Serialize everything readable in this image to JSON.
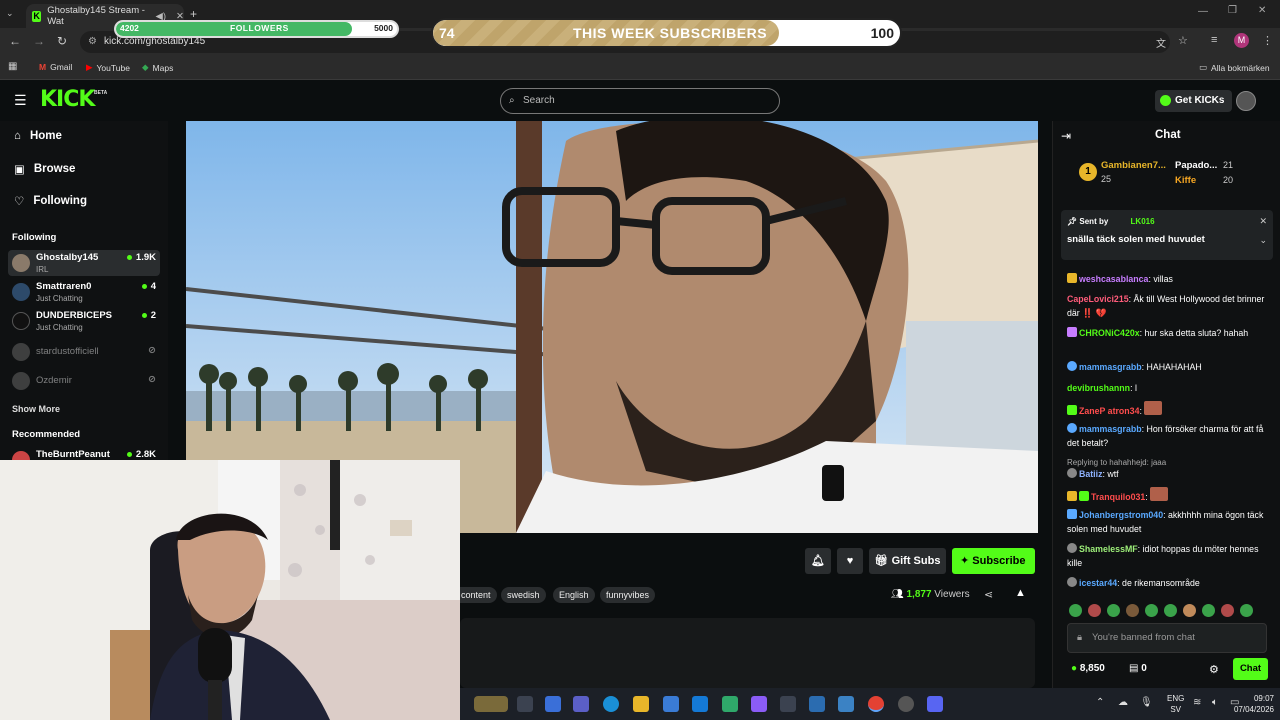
{
  "browser": {
    "tab_title": "Ghostalby145 Stream - Wat",
    "url": "kick.com/ghostalby145",
    "bookmarks": [
      "Gmail",
      "YouTube",
      "Maps"
    ],
    "all_bookmarks": "Alla bokmärken",
    "profile_initial": "M"
  },
  "overlay": {
    "followers_label": "FOLLOWERS",
    "followers_current": "4202",
    "followers_goal": "5000",
    "followers_progress": 0.84,
    "subs_label": "THIS WEEK SUBSCRIBERS",
    "subs_current": "74",
    "subs_goal": "100",
    "subs_progress": 0.74
  },
  "header": {
    "logo": "KICK",
    "beta": "BETA",
    "search_placeholder": "Search",
    "get_kicks": "Get KICKs"
  },
  "sidebar": {
    "nav": [
      {
        "label": "Home",
        "icon": "home-icon"
      },
      {
        "label": "Browse",
        "icon": "browse-icon"
      },
      {
        "label": "Following",
        "icon": "heart-icon"
      }
    ],
    "following_title": "Following",
    "following": [
      {
        "name": "Ghostalby145",
        "sub": "IRL",
        "count": "1.9K",
        "live": true
      },
      {
        "name": "Smattraren0",
        "sub": "Just Chatting",
        "count": "4",
        "live": true
      },
      {
        "name": "DUNDERBICEPS",
        "sub": "Just Chatting",
        "count": "2",
        "live": true
      },
      {
        "name": "stardustofficiell",
        "sub": "",
        "count": "",
        "live": false
      },
      {
        "name": "Ozdemir",
        "sub": "",
        "count": "",
        "live": false
      }
    ],
    "show_more": "Show More",
    "recommended_title": "Recommended",
    "recommended": [
      {
        "name": "TheBurntPeanut",
        "count": "2.8K"
      }
    ]
  },
  "stream": {
    "tags": [
      "content",
      "swedish",
      "English",
      "funnyvibes"
    ],
    "gift_subs": "Gift Subs",
    "subscribe": "Subscribe",
    "viewers": "1,877",
    "viewers_label": "Viewers"
  },
  "chat": {
    "title": "Chat",
    "leaderboard": [
      {
        "rank": "1",
        "name": "Gambianen7...",
        "value": "25"
      },
      {
        "name": "Papado...",
        "value": "21"
      },
      {
        "name": "Kiffe",
        "value": "20"
      }
    ],
    "pinned_sent_by": "Sent by",
    "pinned_user": "LK016",
    "pinned_message": "snälla täck solen med huvudet",
    "messages": [
      {
        "user": "weshcasablanca",
        "color": "#c77dff",
        "text": "villas"
      },
      {
        "user": "CapeLovici215",
        "color": "#ff5c7a",
        "text": "Åk till West Hollywood det brinner där ‼️ 💔"
      },
      {
        "user": "CHRONiC420x",
        "color": "#53fc18",
        "text": "hur ska detta sluta? hahah"
      },
      {
        "user": "mammasgrabb",
        "color": "#5aa9ff",
        "text": "HAHAHAHAH"
      },
      {
        "user": "devibrushannn",
        "color": "#53fc18",
        "text": "l"
      },
      {
        "user": "ZaneP atron34",
        "color": "#ff4d4d",
        "text": ""
      },
      {
        "user": "mammasgrabb",
        "color": "#5aa9ff",
        "text": "Hon försöker charma för att få det betalt?"
      },
      {
        "user": "Batiiz",
        "color": "#8fb3ff",
        "text": "wtf"
      },
      {
        "user": "Tranquilo031",
        "color": "#ff4d4d",
        "text": ""
      },
      {
        "user": "Johanbergstrom040",
        "color": "#5aa9ff",
        "text": "akkhhhh mina ögon täck solen med huvudet"
      },
      {
        "user": "ShamelessMF",
        "color": "#9ef07a",
        "text": "idiot hoppas du möter hennes kille"
      },
      {
        "user": "icestar44",
        "color": "#5aa9ff",
        "text": "de rikemansområde"
      }
    ],
    "reply_context": "Replying to hahahhejd: jaaa",
    "banned_placeholder": "You're banned from chat",
    "kicks_balance": "8,850",
    "gift_count": "0",
    "chat_button": "Chat"
  },
  "taskbar": {
    "language": "ENG",
    "region": "SV",
    "time": "09:07",
    "date": "07/04/2026"
  },
  "colors": {
    "kick_green": "#53fc18",
    "bg": "#0b0e0f",
    "follow_bar": "#44b865",
    "subs_bar": "#c9b07a"
  }
}
